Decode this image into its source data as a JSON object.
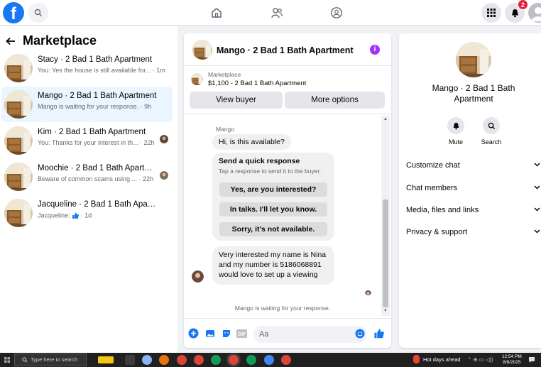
{
  "topbar": {
    "logo": "f",
    "notification_count": "2"
  },
  "left": {
    "title": "Marketplace",
    "conversations": [
      {
        "title": "Stacy · 2 Bad 1 Bath Apartment",
        "snippet": "You: Yes the house is still available for... · 1m"
      },
      {
        "title": "Mango · 2 Bad 1 Bath Apartment",
        "snippet": "Mango is waiting for your response. · 9h"
      },
      {
        "title": "Kim · 2 Bad 1 Bath Apartment",
        "snippet": "You: Thanks for your interest in th... · 22h"
      },
      {
        "title": "Moochie · 2 Bad 1 Bath Apartme...",
        "snippet": "Beware of common scams using ... · 22h"
      },
      {
        "title": "Jacqueline · 2 Bad 1 Bath Apartment",
        "snippet_prefix": "Jacqueline:",
        "snippet_suffix": "· 1d"
      }
    ]
  },
  "chat": {
    "title": "Mango · 2 Bad 1 Bath Apartment",
    "marketplace_label": "Marketplace",
    "listing": "$1,100 - 2 Bad 1 Bath Apartment",
    "view_buyer": "View buyer",
    "more_options": "More options",
    "sender": "Mango",
    "first_message": "Hi, is this available?",
    "quick_title": "Send a quick response",
    "quick_sub": "Tap a response to send it to the buyer.",
    "quick_options": [
      "Yes, are you interested?",
      "In talks. I'll let you know.",
      "Sorry, it's not available."
    ],
    "long_message": "Very interested my name is Nina and my number is 5186068891 would love to set up a viewing",
    "waiting": "Mango is waiting for your response.",
    "input_placeholder": "Aa",
    "gif_label": "GIF"
  },
  "right": {
    "title": "Mango · 2 Bad 1 Bath Apartment",
    "mute": "Mute",
    "search": "Search",
    "sections": [
      "Customize chat",
      "Chat members",
      "Media, files and links",
      "Privacy & support"
    ]
  },
  "taskbar": {
    "search_placeholder": "Type here to search",
    "weather": "Hot days ahead",
    "time": "12:54 PM",
    "date": "8/8/2025"
  },
  "colors": {
    "brand": "#1877f2",
    "active_row": "#ebf5ff",
    "info_icon": "#a033ff",
    "badge": "#e41e3f"
  }
}
